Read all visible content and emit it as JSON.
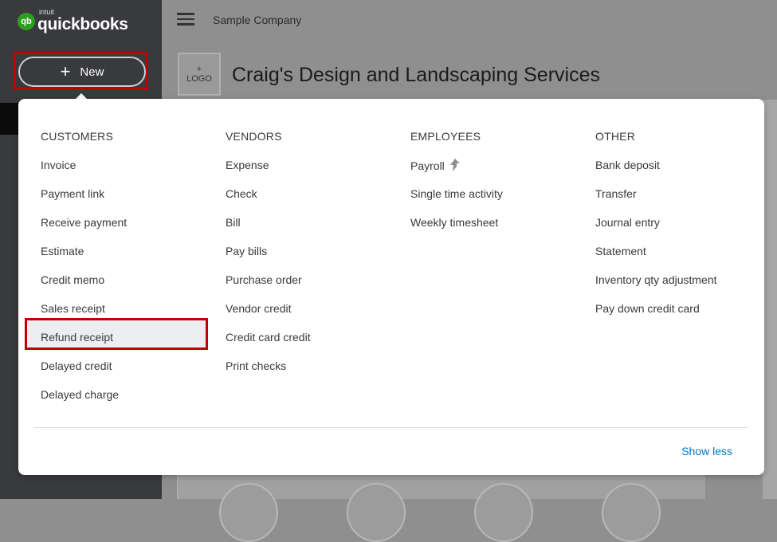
{
  "app": {
    "logo_mark": "qb",
    "logo_intuit": "intuit",
    "logo_name": "quickbooks"
  },
  "sidebar": {
    "new_button": {
      "icon": "+",
      "label": "New"
    }
  },
  "header": {
    "company_short": "Sample Company",
    "company_name": "Craig's Design and Landscaping Services"
  },
  "logo_placeholder": {
    "plus": "+",
    "label": "LOGO"
  },
  "menu": {
    "customers": {
      "heading": "CUSTOMERS",
      "items": [
        "Invoice",
        "Payment link",
        "Receive payment",
        "Estimate",
        "Credit memo",
        "Sales receipt",
        "Refund receipt",
        "Delayed credit",
        "Delayed charge"
      ]
    },
    "vendors": {
      "heading": "VENDORS",
      "items": [
        "Expense",
        "Check",
        "Bill",
        "Pay bills",
        "Purchase order",
        "Vendor credit",
        "Credit card credit",
        "Print checks"
      ]
    },
    "employees": {
      "heading": "EMPLOYEES",
      "items": [
        "Payroll",
        "Single time activity",
        "Weekly timesheet"
      ]
    },
    "other": {
      "heading": "OTHER",
      "items": [
        "Bank deposit",
        "Transfer",
        "Journal entry",
        "Statement",
        "Inventory qty adjustment",
        "Pay down credit card"
      ]
    },
    "show_less": "Show less"
  },
  "colors": {
    "accent_link": "#0077c5",
    "highlight_border": "#c00000",
    "brand_green": "#2ca01c"
  }
}
